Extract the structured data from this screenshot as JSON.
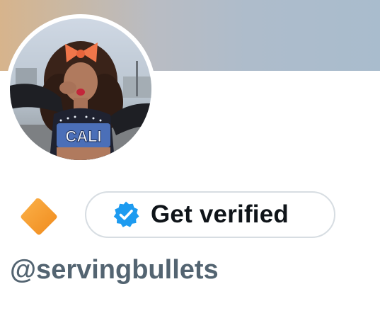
{
  "profile": {
    "handle": "@servingbullets",
    "avatar_icon": "profile-photo",
    "emoji_icon": "orange-diamond-icon",
    "shirt_text": "CALI"
  },
  "verify_button": {
    "label": "Get verified",
    "icon": "verified-badge-icon"
  },
  "colors": {
    "verified_blue": "#1d9bf0",
    "handle_gray": "#536471",
    "text_dark": "#0f1419",
    "pill_border": "#d7dde2",
    "emoji_orange": "#f59a23"
  }
}
